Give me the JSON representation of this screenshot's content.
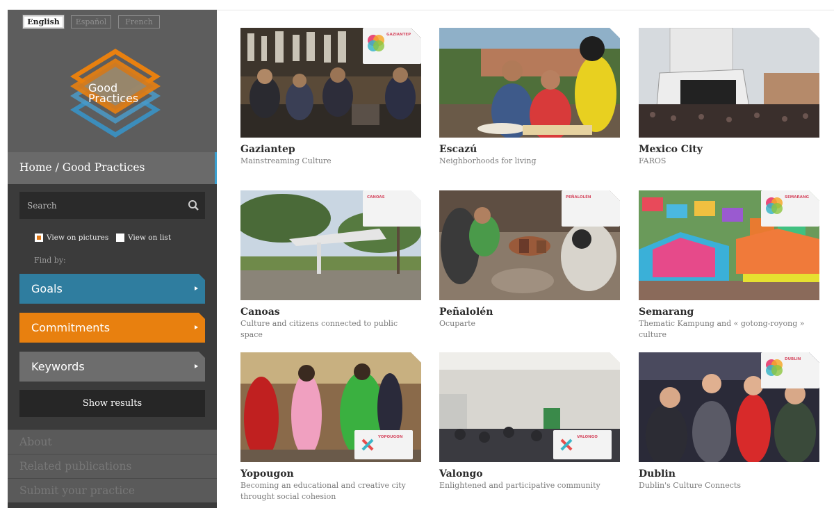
{
  "languages": [
    {
      "label": "English",
      "active": true
    },
    {
      "label": "Español",
      "active": false
    },
    {
      "label": "French",
      "active": false
    }
  ],
  "logo": {
    "line1": "Good",
    "line2": "Practices"
  },
  "breadcrumb": "Home / Good Practices",
  "search": {
    "placeholder": "Search"
  },
  "view_options": {
    "pictures": "View on pictures",
    "list": "View on list"
  },
  "findby": "Find by:",
  "filters": {
    "goals": "Goals",
    "commitments": "Commitments",
    "keywords": "Keywords"
  },
  "show_results": "Show results",
  "bottom_links": [
    "About",
    "Related publications",
    "Submit your practice"
  ],
  "cards": [
    {
      "city": "Gaziantep",
      "desc": "Mainstreaming Culture",
      "badge": "GAZIANTEP"
    },
    {
      "city": "Escazú",
      "desc": "Neighborhoods for living"
    },
    {
      "city": "Mexico City",
      "desc": "FAROS"
    },
    {
      "city": "Canoas",
      "desc": "Culture and citizens connected to public space",
      "badge": "CANOAS"
    },
    {
      "city": "Peñalolén",
      "desc": "Ocuparte",
      "badge": "PEÑALOLÉN"
    },
    {
      "city": "Semarang",
      "desc": "Thematic Kampung and « gotong-royong » culture",
      "badge": "SEMARANG"
    },
    {
      "city": "Yopougon",
      "desc": "Becoming an educational and creative city throught social cohesion",
      "badge": "YOPOUGON"
    },
    {
      "city": "Valongo",
      "desc": "Enlightened and participative community",
      "badge": "VALONGO"
    },
    {
      "city": "Dublin",
      "desc": "Dublin's Culture Connects",
      "badge": "DUBLIN"
    }
  ],
  "colors": {
    "goals": "#2f7d9f",
    "commitments": "#e8800f",
    "keywords": "#6d6d6d",
    "accent": "#3aa0d0"
  }
}
